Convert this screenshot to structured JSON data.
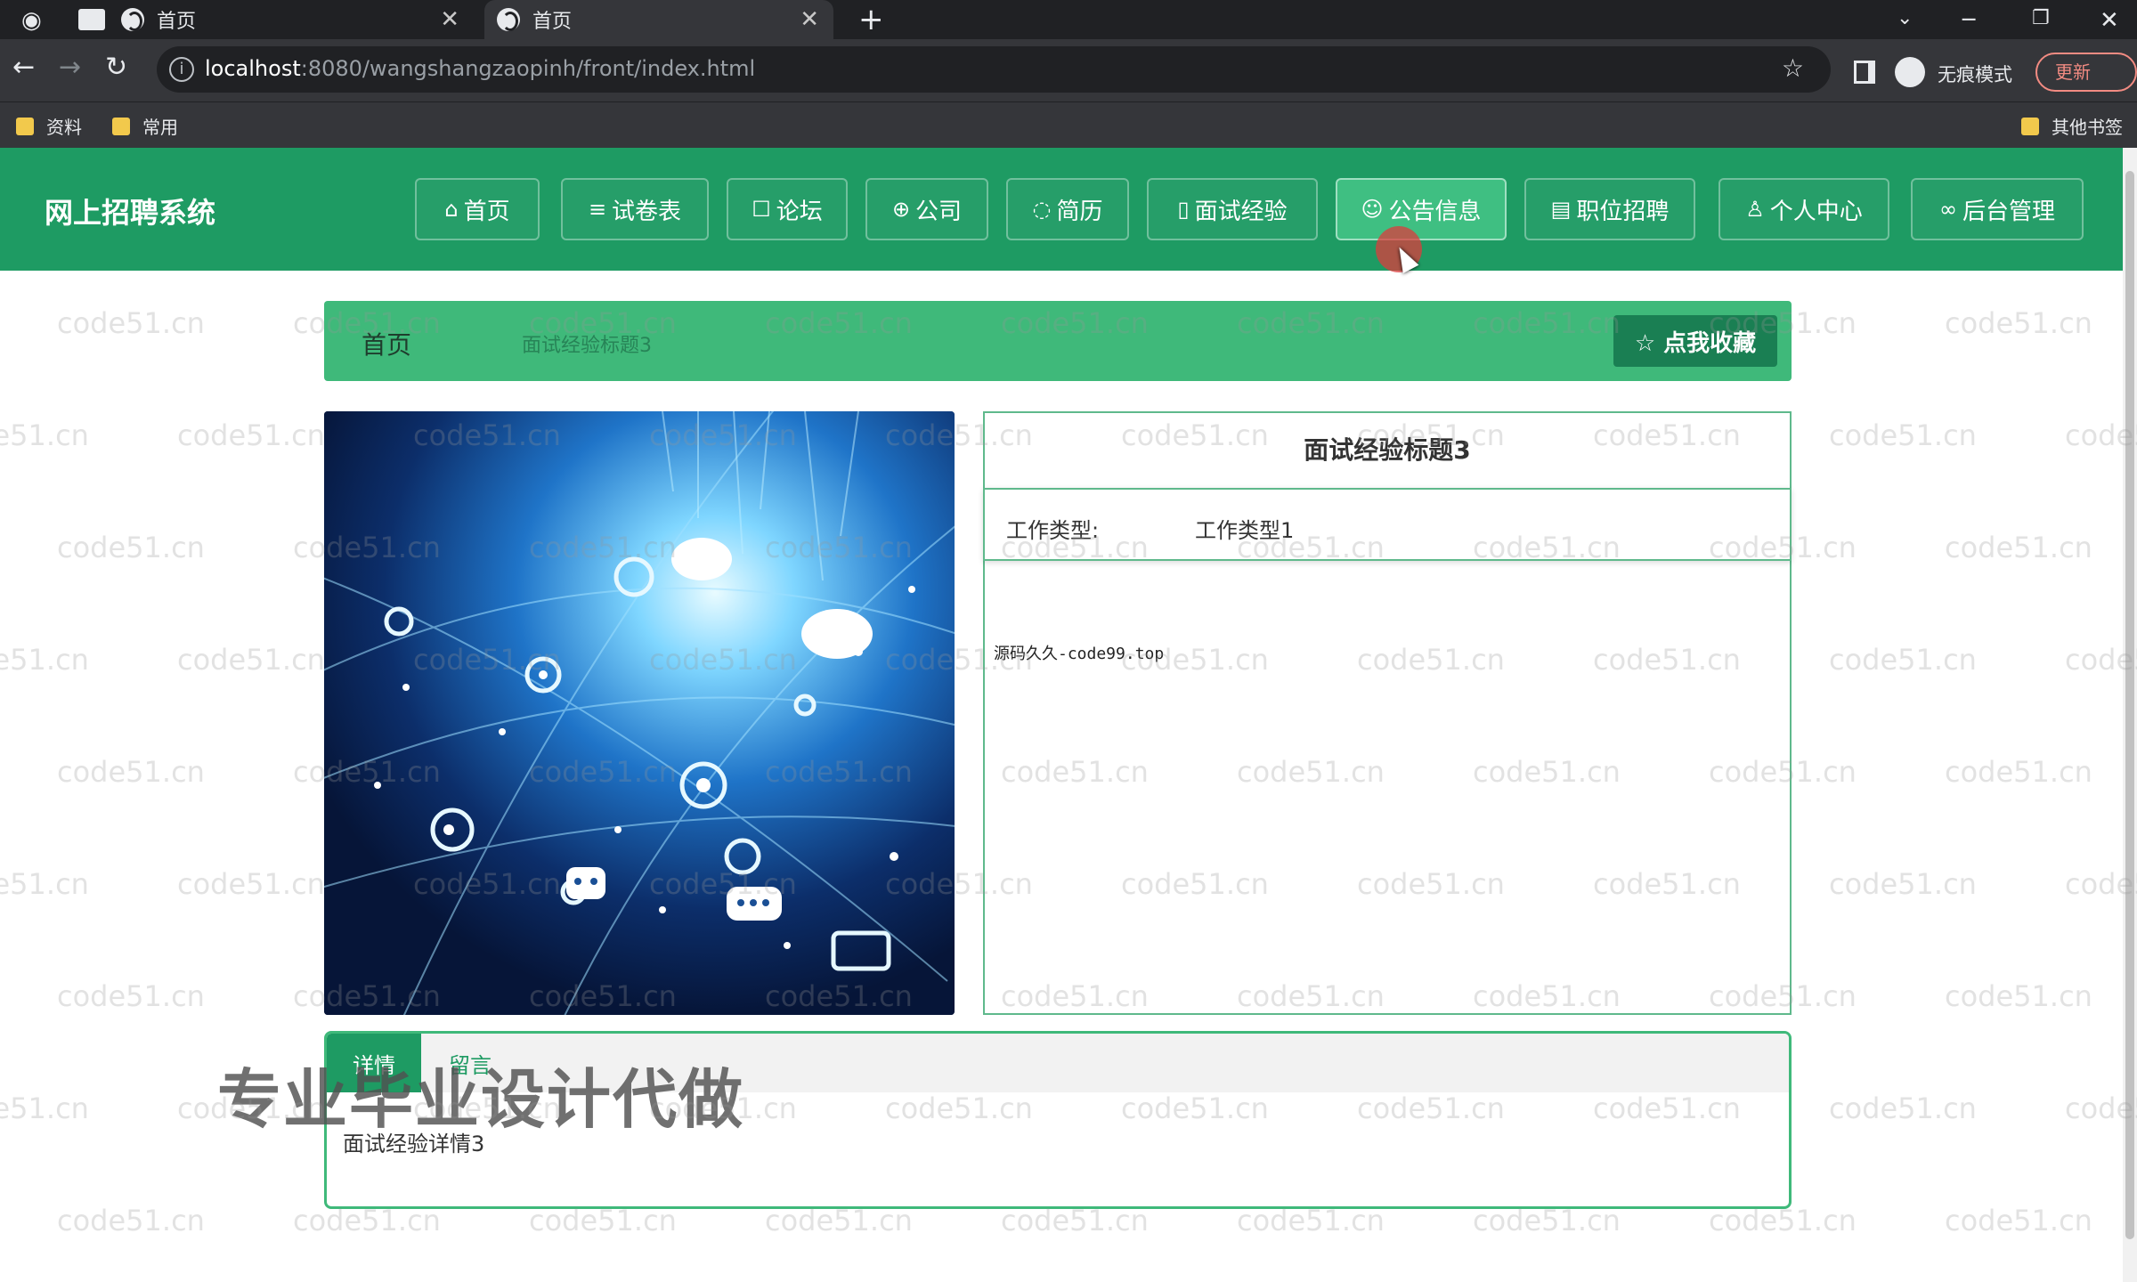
{
  "browser": {
    "tabs": [
      {
        "title": "首页"
      },
      {
        "title": "首页"
      }
    ],
    "new_tab_label": "+",
    "address": {
      "host": "localhost",
      "path": ":8080/wangshangzaopinh/front/index.html"
    },
    "incognito_label": "无痕模式",
    "update_label": "更新",
    "bookmarks": [
      {
        "label": "资料"
      },
      {
        "label": "常用"
      }
    ],
    "other_bookmarks_label": "其他书签"
  },
  "site": {
    "title": "网上招聘系统",
    "menu": [
      {
        "label": "首页",
        "icon": "home-icon",
        "glyph": "⌂"
      },
      {
        "label": "试卷表",
        "icon": "list-icon",
        "glyph": "≡"
      },
      {
        "label": "论坛",
        "icon": "forum-icon",
        "glyph": "☐"
      },
      {
        "label": "公司",
        "icon": "globe-icon",
        "glyph": "⊕"
      },
      {
        "label": "简历",
        "icon": "palette-icon",
        "glyph": "◌"
      },
      {
        "label": "面试经验",
        "icon": "book-icon",
        "glyph": "▯"
      },
      {
        "label": "公告信息",
        "icon": "smile-icon",
        "glyph": "☺"
      },
      {
        "label": "职位招聘",
        "icon": "document-icon",
        "glyph": "▤"
      },
      {
        "label": "个人中心",
        "icon": "user-icon",
        "glyph": "♙"
      },
      {
        "label": "后台管理",
        "icon": "link-icon",
        "glyph": "∞"
      }
    ],
    "active_menu_index": 6
  },
  "breadcrumb": {
    "home": "首页",
    "current": "面试经验标题3",
    "favorite_label": "☆ 点我收藏"
  },
  "detail_info": {
    "title": "面试经验标题3",
    "field_label": "工作类型:",
    "field_value": "工作类型1",
    "note": "源码久久-code99.top"
  },
  "detail_tabs": {
    "active": "详情",
    "inactive": "留言",
    "content": "面试经验详情3"
  },
  "overlay": {
    "promo_text": "专业毕业设计代做",
    "watermark_text": "code51.cn"
  },
  "colors": {
    "primary_green": "#1e9b63",
    "breadcrumb_green": "#3fb97a",
    "active_menu": "#3fbf82"
  }
}
